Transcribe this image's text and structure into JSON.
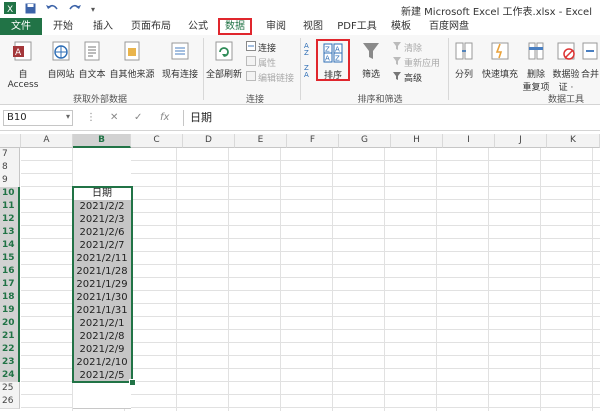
{
  "app": {
    "title": "新建 Microsoft Excel 工作表.xlsx - Excel"
  },
  "tabs": [
    "文件",
    "开始",
    "插入",
    "页面布局",
    "公式",
    "数据",
    "审阅",
    "视图",
    "PDF工具",
    "模板",
    "百度网盘"
  ],
  "ribbon": {
    "get_external": {
      "from_access": "自 Access",
      "from_web": "自网站",
      "from_text": "自文本",
      "from_other": "自其他来源",
      "existing": "现有连接",
      "group_label": "获取外部数据"
    },
    "connections": {
      "refresh_all": "全部刷新",
      "connections": "连接",
      "properties": "属性",
      "edit_links": "编辑链接",
      "group_label": "连接"
    },
    "sort_filter": {
      "sort": "排序",
      "filter": "筛选",
      "clear": "清除",
      "reapply": "重新应用",
      "advanced": "高级",
      "group_label": "排序和筛选"
    },
    "data_tools": {
      "text_to_columns": "分列",
      "flash_fill": "快速填充",
      "remove_dup_1": "删除",
      "remove_dup_2": "重复项",
      "validation_1": "数据验",
      "validation_2": "证 ·",
      "consolidate": "合并",
      "group_label": "数据工具"
    }
  },
  "formula_bar": {
    "name_box": "B10",
    "fx": "fx",
    "content": "日期"
  },
  "columns": [
    "A",
    "B",
    "C",
    "D",
    "E",
    "F",
    "G",
    "H",
    "I",
    "J",
    "K"
  ],
  "rows": [
    "7",
    "8",
    "9",
    "10",
    "11",
    "12",
    "13",
    "14",
    "15",
    "16",
    "17",
    "18",
    "19",
    "20",
    "21",
    "22",
    "23",
    "24",
    "25",
    "26"
  ],
  "column_b": [
    "",
    "",
    "",
    "日期",
    "2021/2/2",
    "2021/2/3",
    "2021/2/6",
    "2021/2/7",
    "2021/2/11",
    "2021/1/28",
    "2021/1/29",
    "2021/1/30",
    "2021/1/31",
    "2021/2/1",
    "2021/2/8",
    "2021/2/9",
    "2021/2/10",
    "2021/2/5",
    "",
    ""
  ],
  "colors": {
    "excel_green": "#217346",
    "highlight_red": "#e0262d",
    "selection_gray": "#c6c6c6"
  }
}
